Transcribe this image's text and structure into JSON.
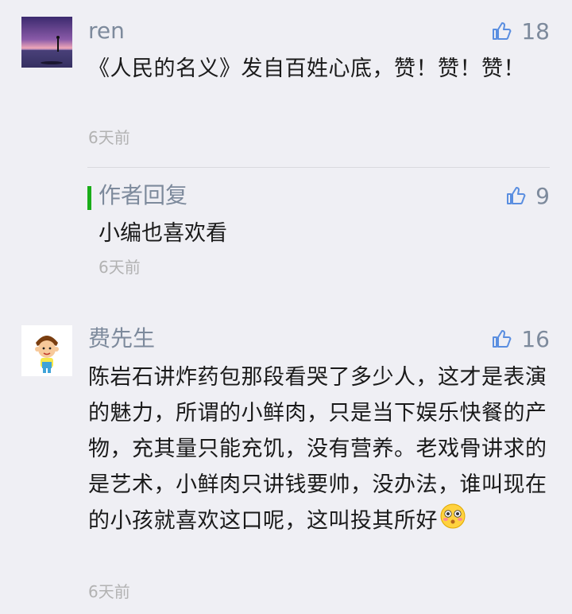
{
  "comments": [
    {
      "username": "ren",
      "likes": "18",
      "text": "《人民的名义》发自百姓心底，赞！赞！赞！",
      "time": "6天前",
      "reply": {
        "title": "作者回复",
        "likes": "9",
        "text": "小编也喜欢看",
        "time": "6天前"
      }
    },
    {
      "username": "费先生",
      "likes": "16",
      "text": "陈岩石讲炸药包那段看哭了多少人，这才是表演的魅力，所谓的小鲜肉，只是当下娱乐快餐的产物，充其量只能充饥，没有营养。老戏骨讲求的是艺术，小鲜肉只讲钱要帅，没办法，谁叫现在的小孩就喜欢这口呢，这叫投其所好",
      "time": "6天前"
    }
  ],
  "colors": {
    "background": "#efeff4",
    "name": "#7d8a9c",
    "text": "#1a1a1a",
    "time": "#b2b2b2",
    "reply_bar": "#1aad19"
  },
  "icons": {
    "like": "thumbs-up-icon",
    "emoji": "flushed-face-icon"
  }
}
